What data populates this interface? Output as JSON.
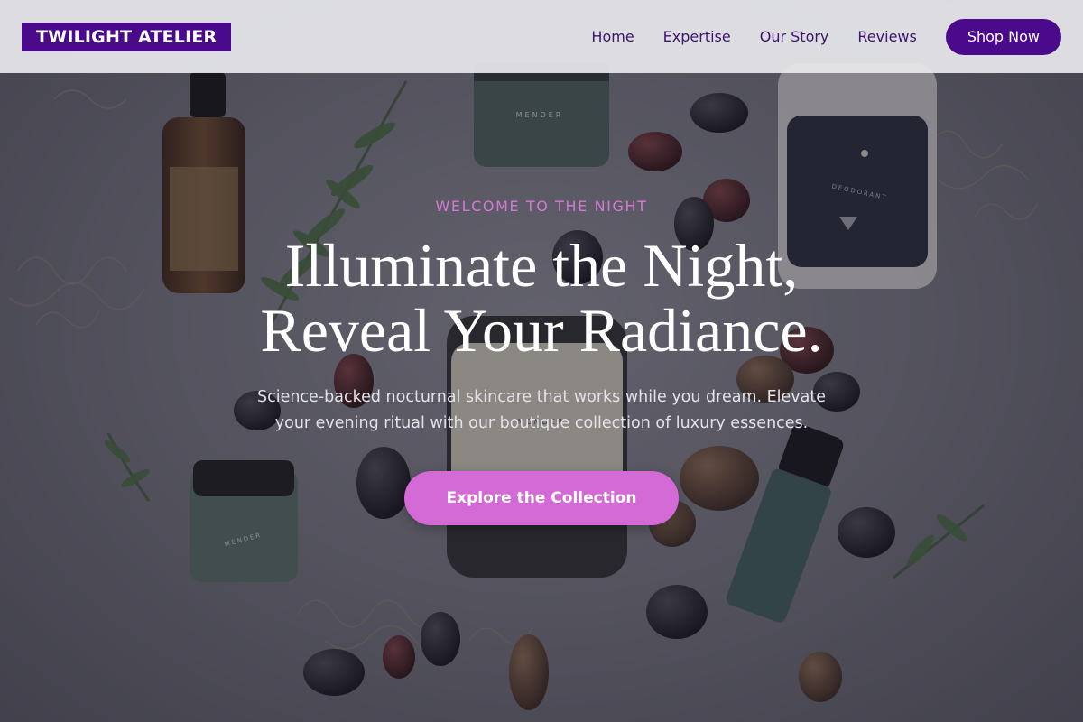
{
  "brand": {
    "name": "TWILIGHT ATELIER"
  },
  "nav": {
    "items": [
      {
        "label": "Home"
      },
      {
        "label": "Expertise"
      },
      {
        "label": "Our Story"
      },
      {
        "label": "Reviews"
      }
    ],
    "cta_label": "Shop Now"
  },
  "hero": {
    "eyebrow": "WELCOME TO THE NIGHT",
    "headline_line1": "Illuminate the Night,",
    "headline_line2": "Reveal Your Radiance.",
    "subtitle": "Science-backed nocturnal skincare that works while you dream. Elevate your evening ritual with our boutique collection of luxury essences.",
    "cta_label": "Explore the Collection",
    "image_label_texts": [
      "MENDER",
      "DEODORANT",
      "MENDER",
      "MENDER"
    ]
  },
  "colors": {
    "brand_purple": "#4b0a8c",
    "accent_pink": "#d46ad6",
    "eyebrow_pink": "#d678d8",
    "header_bg": "#e8e8ec"
  }
}
